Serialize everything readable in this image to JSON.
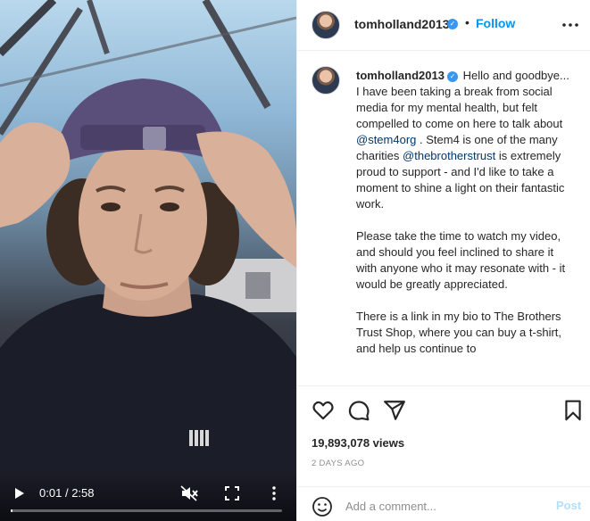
{
  "video": {
    "current_time": "0:01",
    "separator": "/",
    "duration": "2:58",
    "progress_fraction": 0.006,
    "muted": true
  },
  "post": {
    "username": "tomholland2013",
    "verified": true,
    "follow_label": "Follow",
    "caption_segments": [
      {
        "text": "Hello and goodbye... I have been taking a break from social media for my mental health, but felt compelled to come on here to talk about ",
        "type": "text"
      },
      {
        "text": "@stem4org",
        "type": "mention"
      },
      {
        "text": " . Stem4 is one of the many charities ",
        "type": "text"
      },
      {
        "text": "@thebrotherstrust",
        "type": "mention"
      },
      {
        "text": " is extremely proud to support - and I'd like to take a moment to shine a light on their fantastic work.\n\nPlease take the time to watch my video, and should you feel inclined to share it with anyone who it may resonate with - it would be greatly appreciated.\n\nThere is a link in my bio to The Brothers Trust Shop, where you can buy a t-shirt, and help us continue to",
        "type": "text"
      }
    ],
    "views": "19,893,078 views",
    "timestamp": "2 DAYS AGO"
  },
  "comment_form": {
    "placeholder": "Add a comment...",
    "post_label": "Post"
  },
  "icons": {
    "play": "play-icon",
    "mute": "muted-speaker-icon",
    "fullscreen": "fullscreen-icon",
    "video_more": "vertical-dots-icon",
    "header_more": "horizontal-dots-icon",
    "like": "heart-icon",
    "comment": "speech-bubble-icon",
    "share": "paper-plane-icon",
    "save": "bookmark-icon",
    "emoji": "smiley-icon"
  },
  "colors": {
    "accent": "#0095f6",
    "mention": "#00376b",
    "muted_text": "#8e8e8e",
    "post_disabled": "#b2dffc",
    "verified_badge": "#3897f0"
  }
}
